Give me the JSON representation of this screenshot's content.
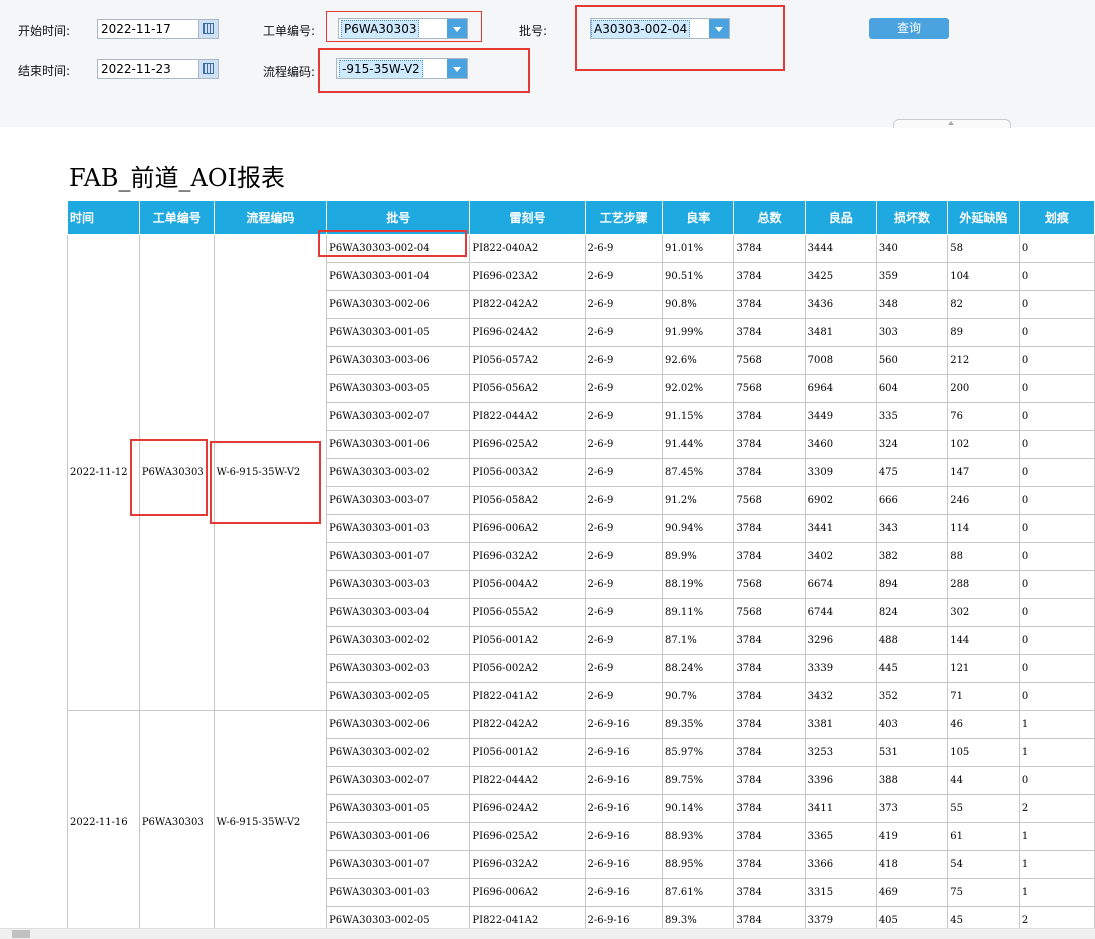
{
  "filters": {
    "start_label": "开始时间:",
    "start_value": "2022-11-17",
    "end_label": "结束时间:",
    "end_value": "2022-11-23",
    "order_label": "工单编号:",
    "order_value": "P6WA30303",
    "flow_label": "流程编码:",
    "flow_value": "-915-35W-V2",
    "batch_label": "批号:",
    "batch_value": "A30303-002-04",
    "query_label": "查询"
  },
  "report_title": "FAB_前道_AOI报表",
  "columns": [
    "时间",
    "工单编号",
    "流程编码",
    "批号",
    "雷刻号",
    "工艺步骤",
    "良率",
    "总数",
    "良品",
    "损坏数",
    "外延缺陷",
    "划痕"
  ],
  "groups": [
    {
      "time": "2022-11-12",
      "order": "P6WA30303",
      "flow": "W-6-915-35W-V2",
      "rows": [
        [
          "P6WA30303-002-04",
          "PI822-040A2",
          "2-6-9",
          "91.01%",
          "3784",
          "3444",
          "340",
          "58",
          "0"
        ],
        [
          "P6WA30303-001-04",
          "PI696-023A2",
          "2-6-9",
          "90.51%",
          "3784",
          "3425",
          "359",
          "104",
          "0"
        ],
        [
          "P6WA30303-002-06",
          "PI822-042A2",
          "2-6-9",
          "90.8%",
          "3784",
          "3436",
          "348",
          "82",
          "0"
        ],
        [
          "P6WA30303-001-05",
          "PI696-024A2",
          "2-6-9",
          "91.99%",
          "3784",
          "3481",
          "303",
          "89",
          "0"
        ],
        [
          "P6WA30303-003-06",
          "PI056-057A2",
          "2-6-9",
          "92.6%",
          "7568",
          "7008",
          "560",
          "212",
          "0"
        ],
        [
          "P6WA30303-003-05",
          "PI056-056A2",
          "2-6-9",
          "92.02%",
          "7568",
          "6964",
          "604",
          "200",
          "0"
        ],
        [
          "P6WA30303-002-07",
          "PI822-044A2",
          "2-6-9",
          "91.15%",
          "3784",
          "3449",
          "335",
          "76",
          "0"
        ],
        [
          "P6WA30303-001-06",
          "PI696-025A2",
          "2-6-9",
          "91.44%",
          "3784",
          "3460",
          "324",
          "102",
          "0"
        ],
        [
          "P6WA30303-003-02",
          "PI056-003A2",
          "2-6-9",
          "87.45%",
          "3784",
          "3309",
          "475",
          "147",
          "0"
        ],
        [
          "P6WA30303-003-07",
          "PI056-058A2",
          "2-6-9",
          "91.2%",
          "7568",
          "6902",
          "666",
          "246",
          "0"
        ],
        [
          "P6WA30303-001-03",
          "PI696-006A2",
          "2-6-9",
          "90.94%",
          "3784",
          "3441",
          "343",
          "114",
          "0"
        ],
        [
          "P6WA30303-001-07",
          "PI696-032A2",
          "2-6-9",
          "89.9%",
          "3784",
          "3402",
          "382",
          "88",
          "0"
        ],
        [
          "P6WA30303-003-03",
          "PI056-004A2",
          "2-6-9",
          "88.19%",
          "7568",
          "6674",
          "894",
          "288",
          "0"
        ],
        [
          "P6WA30303-003-04",
          "PI056-055A2",
          "2-6-9",
          "89.11%",
          "7568",
          "6744",
          "824",
          "302",
          "0"
        ],
        [
          "P6WA30303-002-02",
          "PI056-001A2",
          "2-6-9",
          "87.1%",
          "3784",
          "3296",
          "488",
          "144",
          "0"
        ],
        [
          "P6WA30303-002-03",
          "PI056-002A2",
          "2-6-9",
          "88.24%",
          "3784",
          "3339",
          "445",
          "121",
          "0"
        ],
        [
          "P6WA30303-002-05",
          "PI822-041A2",
          "2-6-9",
          "90.7%",
          "3784",
          "3432",
          "352",
          "71",
          "0"
        ]
      ]
    },
    {
      "time": "2022-11-16",
      "order": "P6WA30303",
      "flow": "W-6-915-35W-V2",
      "rows": [
        [
          "P6WA30303-002-06",
          "PI822-042A2",
          "2-6-9-16",
          "89.35%",
          "3784",
          "3381",
          "403",
          "46",
          "1"
        ],
        [
          "P6WA30303-002-02",
          "PI056-001A2",
          "2-6-9-16",
          "85.97%",
          "3784",
          "3253",
          "531",
          "105",
          "1"
        ],
        [
          "P6WA30303-002-07",
          "PI822-044A2",
          "2-6-9-16",
          "89.75%",
          "3784",
          "3396",
          "388",
          "44",
          "0"
        ],
        [
          "P6WA30303-001-05",
          "PI696-024A2",
          "2-6-9-16",
          "90.14%",
          "3784",
          "3411",
          "373",
          "55",
          "2"
        ],
        [
          "P6WA30303-001-06",
          "PI696-025A2",
          "2-6-9-16",
          "88.93%",
          "3784",
          "3365",
          "419",
          "61",
          "1"
        ],
        [
          "P6WA30303-001-07",
          "PI696-032A2",
          "2-6-9-16",
          "88.95%",
          "3784",
          "3366",
          "418",
          "54",
          "1"
        ],
        [
          "P6WA30303-001-03",
          "PI696-006A2",
          "2-6-9-16",
          "87.61%",
          "3784",
          "3315",
          "469",
          "75",
          "1"
        ],
        [
          "P6WA30303-002-05",
          "PI822-041A2",
          "2-6-9-16",
          "89.3%",
          "3784",
          "3379",
          "405",
          "45",
          "2"
        ]
      ]
    }
  ]
}
